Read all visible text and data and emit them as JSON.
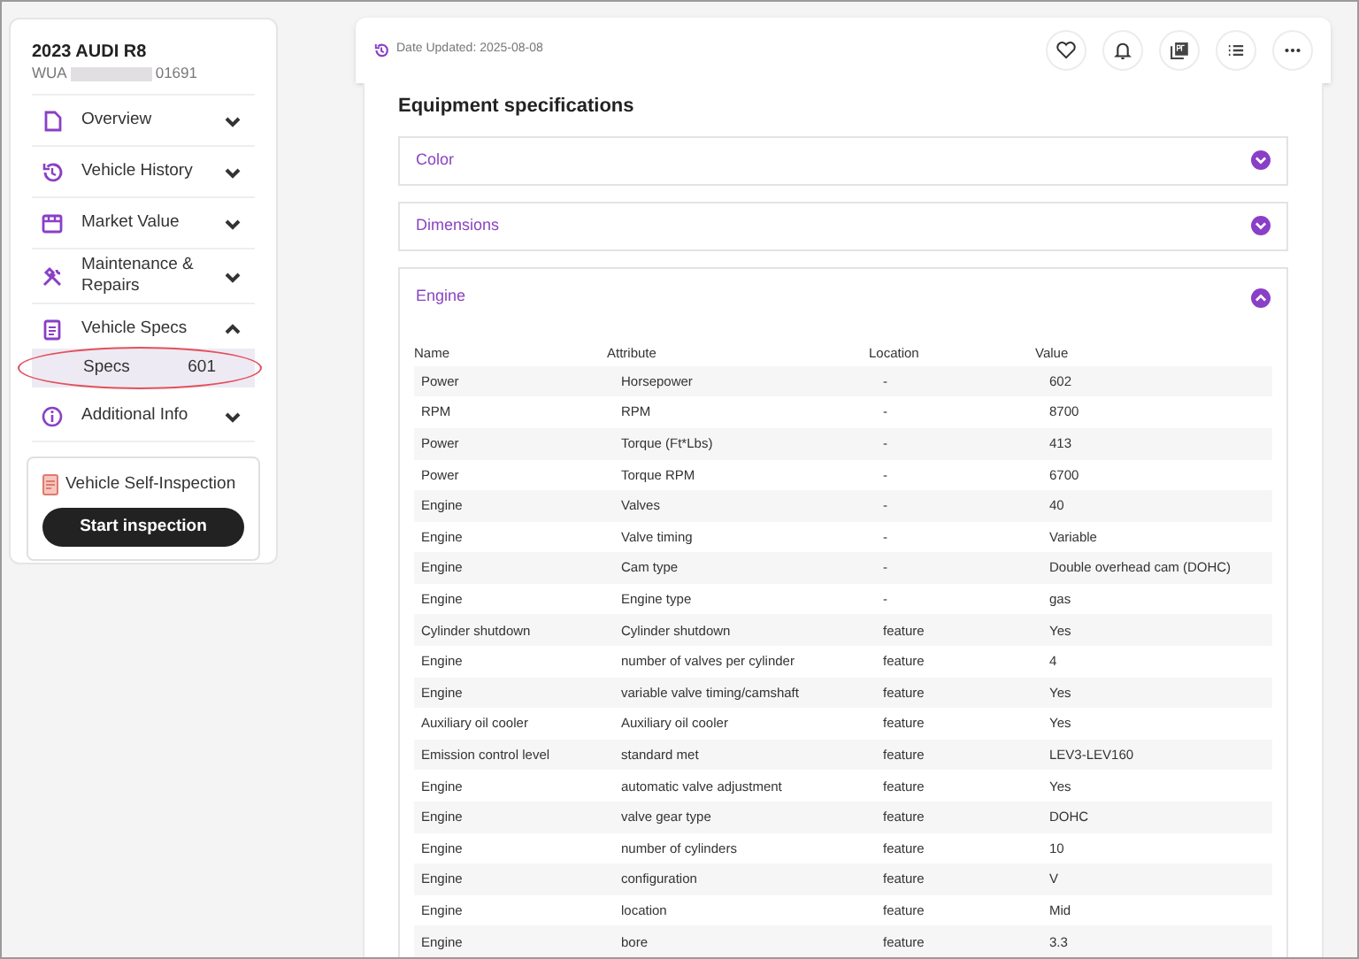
{
  "vehicle": {
    "title": "2023 AUDI R8",
    "vin_start": "WUA",
    "vin_end": "01691"
  },
  "sidebar": {
    "items": [
      {
        "label": "Overview",
        "expanded": false
      },
      {
        "label": "Vehicle History",
        "expanded": false
      },
      {
        "label": "Market Value",
        "expanded": false
      },
      {
        "label": "Maintenance & Repairs",
        "expanded": false
      },
      {
        "label": "Vehicle Specs",
        "expanded": true,
        "children": [
          {
            "label": "Specs",
            "count": "601",
            "selected": true
          }
        ]
      },
      {
        "label": "Additional Info",
        "expanded": false
      }
    ],
    "inspection": {
      "title": "Vehicle Self-Inspection",
      "button": "Start inspection"
    }
  },
  "header": {
    "date_updated": "Date Updated: 2025-08-08"
  },
  "section_title": "Equipment specifications",
  "accordions": [
    {
      "label": "Color",
      "expanded": false
    },
    {
      "label": "Dimensions",
      "expanded": false
    },
    {
      "label": "Engine",
      "expanded": true
    }
  ],
  "table": {
    "columns": [
      "Name",
      "Attribute",
      "Location",
      "Value"
    ],
    "rows": [
      [
        "Power",
        "Horsepower",
        "-",
        "602"
      ],
      [
        "RPM",
        "RPM",
        "-",
        "8700"
      ],
      [
        "Power",
        "Torque (Ft*Lbs)",
        "-",
        "413"
      ],
      [
        "Power",
        "Torque RPM",
        "-",
        "6700"
      ],
      [
        "Engine",
        "Valves",
        "-",
        "40"
      ],
      [
        "Engine",
        "Valve timing",
        "-",
        "Variable"
      ],
      [
        "Engine",
        "Cam type",
        "-",
        "Double overhead cam (DOHC)"
      ],
      [
        "Engine",
        "Engine type",
        "-",
        "gas"
      ],
      [
        "Cylinder shutdown",
        "Cylinder shutdown",
        "feature",
        "Yes"
      ],
      [
        "Engine",
        "number of valves per cylinder",
        "feature",
        "4"
      ],
      [
        "Engine",
        "variable valve timing/camshaft",
        "feature",
        "Yes"
      ],
      [
        "Auxiliary oil cooler",
        "Auxiliary oil cooler",
        "feature",
        "Yes"
      ],
      [
        "Emission control level",
        "standard met",
        "feature",
        "LEV3-LEV160"
      ],
      [
        "Engine",
        "automatic valve adjustment",
        "feature",
        "Yes"
      ],
      [
        "Engine",
        "valve gear type",
        "feature",
        "DOHC"
      ],
      [
        "Engine",
        "number of cylinders",
        "feature",
        "10"
      ],
      [
        "Engine",
        "configuration",
        "feature",
        "V"
      ],
      [
        "Engine",
        "location",
        "feature",
        "Mid"
      ],
      [
        "Engine",
        "bore",
        "feature",
        "3.3"
      ]
    ]
  }
}
